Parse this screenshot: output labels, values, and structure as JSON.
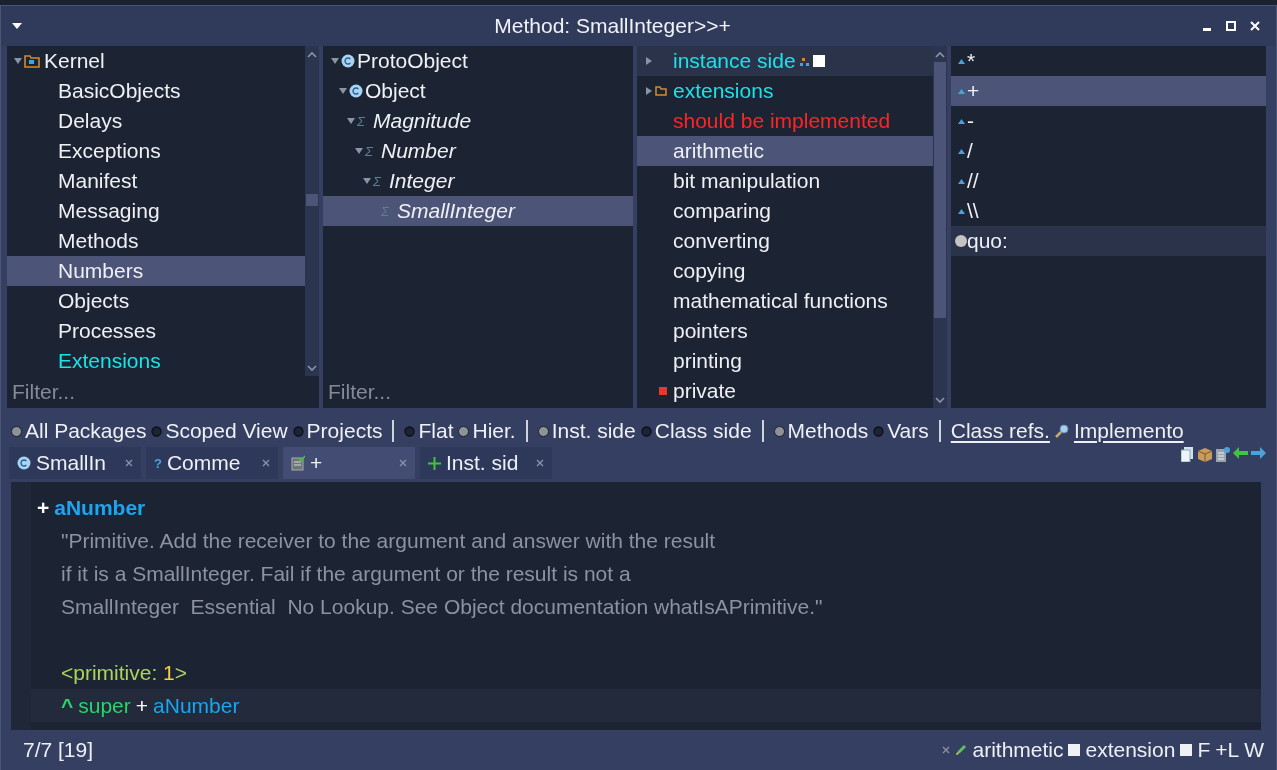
{
  "window": {
    "title": "Method: SmallInteger>>+"
  },
  "packages": {
    "items": [
      {
        "label": "Kernel",
        "kind": "package",
        "expanded": true,
        "selected": false,
        "children": [
          {
            "label": "BasicObjects",
            "kind": "plain",
            "selected": false
          },
          {
            "label": "Delays",
            "kind": "plain",
            "selected": false
          },
          {
            "label": "Exceptions",
            "kind": "plain",
            "selected": false
          },
          {
            "label": "Manifest",
            "kind": "plain",
            "selected": false
          },
          {
            "label": "Messaging",
            "kind": "plain",
            "selected": false
          },
          {
            "label": "Methods",
            "kind": "plain",
            "selected": false
          },
          {
            "label": "Numbers",
            "kind": "plain",
            "selected": true
          },
          {
            "label": "Objects",
            "kind": "plain",
            "selected": false
          },
          {
            "label": "Processes",
            "kind": "plain",
            "selected": false
          },
          {
            "label": "Extensions",
            "kind": "extension",
            "selected": false
          }
        ]
      }
    ],
    "filter": {
      "placeholder": "Filter..."
    }
  },
  "classes": {
    "items": [
      {
        "label": "ProtoObject",
        "kind": "class",
        "expanded": true,
        "selected": false,
        "children": [
          {
            "label": "Object",
            "kind": "class",
            "expanded": true,
            "selected": false,
            "children": [
              {
                "label": "Magnitude",
                "kind": "abstract",
                "symbol": "Σ",
                "expanded": true,
                "selected": false,
                "children": [
                  {
                    "label": "Number",
                    "kind": "abstract",
                    "symbol": "Σ",
                    "expanded": true,
                    "selected": false,
                    "children": [
                      {
                        "label": "Integer",
                        "kind": "abstract",
                        "symbol": "Σ",
                        "expanded": true,
                        "selected": false,
                        "children": [
                          {
                            "label": "SmallInteger",
                            "kind": "abstract",
                            "symbol": "Σ",
                            "selected": true
                          }
                        ]
                      }
                    ]
                  }
                ]
              }
            ]
          }
        ]
      }
    ],
    "filter": {
      "placeholder": "Filter..."
    }
  },
  "protocols": {
    "items": [
      {
        "label": "instance side",
        "kind": "side",
        "expanded": false,
        "selected": false,
        "hovered": true
      },
      {
        "label": "extensions",
        "kind": "extensions",
        "expanded": false,
        "selected": false
      },
      {
        "label": "should be implemented",
        "kind": "missing",
        "selected": false
      },
      {
        "label": "arithmetic",
        "kind": "plain",
        "selected": true
      },
      {
        "label": "bit manipulation",
        "kind": "plain",
        "selected": false
      },
      {
        "label": "comparing",
        "kind": "plain",
        "selected": false
      },
      {
        "label": "converting",
        "kind": "plain",
        "selected": false
      },
      {
        "label": "copying",
        "kind": "plain",
        "selected": false
      },
      {
        "label": "mathematical functions",
        "kind": "plain",
        "selected": false
      },
      {
        "label": "pointers",
        "kind": "plain",
        "selected": false
      },
      {
        "label": "printing",
        "kind": "plain",
        "selected": false
      },
      {
        "label": "private",
        "kind": "private",
        "selected": false
      }
    ]
  },
  "methods": {
    "items": [
      {
        "label": "*",
        "kind": "override",
        "selected": false
      },
      {
        "label": "+",
        "kind": "override",
        "selected": true
      },
      {
        "label": "-",
        "kind": "override",
        "selected": false
      },
      {
        "label": "/",
        "kind": "override",
        "selected": false
      },
      {
        "label": "//",
        "kind": "override",
        "selected": false
      },
      {
        "label": "\\\\",
        "kind": "override",
        "selected": false
      },
      {
        "label": "quo:",
        "kind": "plain",
        "selected": false,
        "hovered": true
      }
    ]
  },
  "options": [
    {
      "kind": "radio",
      "label": "All Packages",
      "checked": true
    },
    {
      "kind": "radio",
      "label": "Scoped View",
      "checked": false
    },
    {
      "kind": "radio",
      "label": "Projects",
      "checked": false
    },
    {
      "kind": "separator"
    },
    {
      "kind": "radio",
      "label": "Flat",
      "checked": false
    },
    {
      "kind": "radio",
      "label": "Hier.",
      "checked": true
    },
    {
      "kind": "separator"
    },
    {
      "kind": "radio",
      "label": "Inst. side",
      "checked": true
    },
    {
      "kind": "radio",
      "label": "Class side",
      "checked": false
    },
    {
      "kind": "separator"
    },
    {
      "kind": "radio",
      "label": "Methods",
      "checked": true
    },
    {
      "kind": "radio",
      "label": "Vars",
      "checked": false
    },
    {
      "kind": "separator"
    },
    {
      "kind": "link",
      "label": "Class refs."
    },
    {
      "kind": "search-link",
      "label": "Implemento"
    }
  ],
  "tabs": [
    {
      "label": "SmallIn",
      "kind": "class",
      "selected": false
    },
    {
      "label": "Comme",
      "kind": "help",
      "icon_text": "?",
      "selected": false
    },
    {
      "label": "+",
      "kind": "method",
      "selected": true
    },
    {
      "label": "Inst. sid",
      "kind": "add",
      "selected": false
    }
  ],
  "editor": {
    "lines": [
      {
        "kind": "signature",
        "parts": [
          {
            "kind": "selector",
            "text": "+"
          },
          {
            "kind": "argument-bold",
            "text": "aNumber"
          }
        ]
      },
      {
        "kind": "body",
        "parts": [
          {
            "kind": "comment",
            "text": "\"Primitive. Add the receiver to the argument and answer with the result"
          }
        ]
      },
      {
        "kind": "body",
        "parts": [
          {
            "kind": "comment",
            "text": "if it is a SmallInteger. Fail if the argument or the result is not a"
          }
        ]
      },
      {
        "kind": "body",
        "parts": [
          {
            "kind": "comment",
            "text": "SmallInteger  Essential  No Lookup. See Object documentation whatIsAPrimitive.\""
          }
        ]
      },
      {
        "kind": "blank"
      },
      {
        "kind": "body",
        "parts": [
          {
            "kind": "pragma",
            "text": "<primitive: "
          },
          {
            "kind": "number",
            "text": "1"
          },
          {
            "kind": "pragma",
            "text": ">"
          }
        ]
      },
      {
        "kind": "body",
        "current": true,
        "parts": [
          {
            "kind": "return",
            "text": "^"
          },
          {
            "kind": "keyword",
            "text": "super"
          },
          {
            "kind": "operator",
            "text": "+"
          },
          {
            "kind": "argument",
            "text": "aNumber"
          }
        ]
      }
    ]
  },
  "status": {
    "position": "7/7 [19]",
    "protocol": "arithmetic",
    "flags": [
      {
        "label": "extension",
        "checked": false
      },
      {
        "label": "F",
        "checked": false
      }
    ],
    "extra": [
      "+L",
      "W"
    ]
  }
}
